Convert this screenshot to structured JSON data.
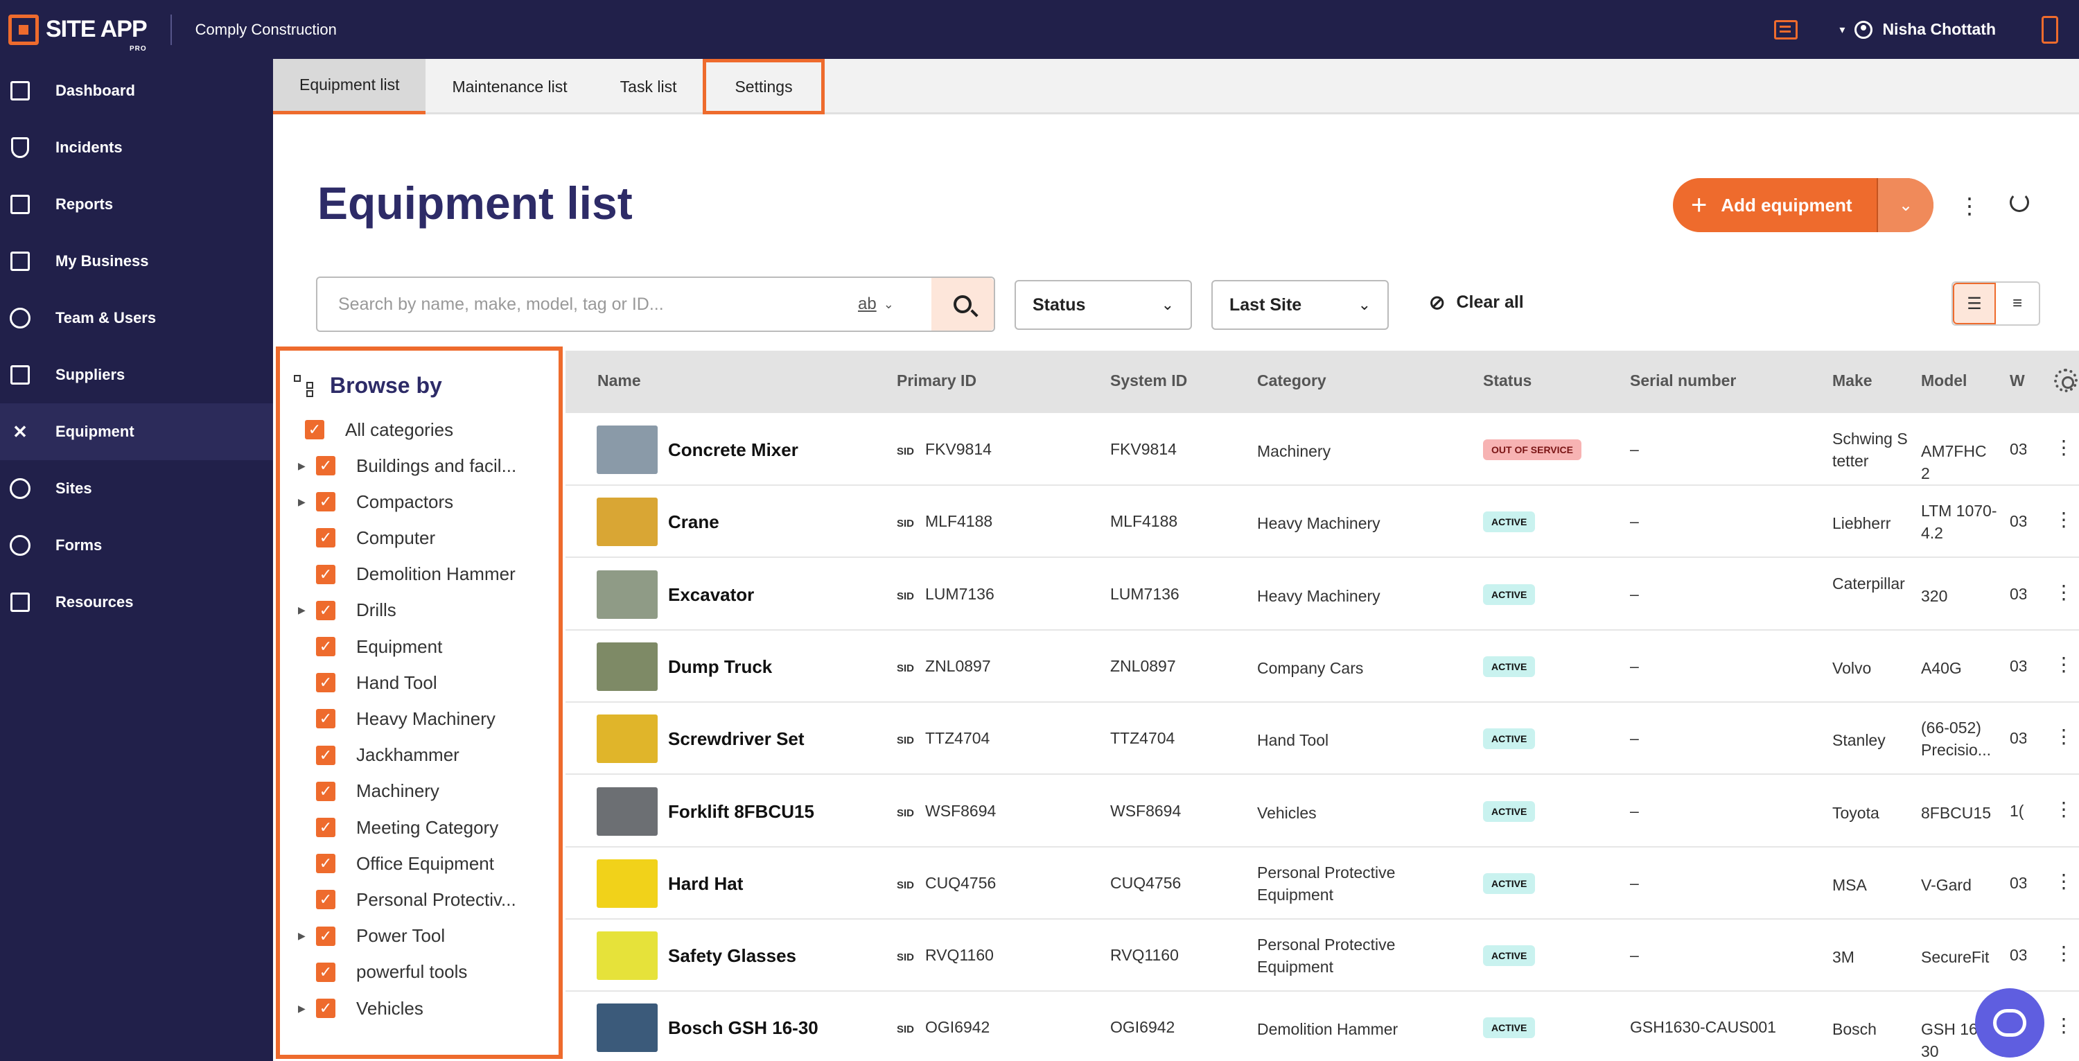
{
  "app": {
    "brand": "SITE APP",
    "brand_tier": "PRO",
    "company": "Comply Construction",
    "user": "Nisha Chottath"
  },
  "colors": {
    "accent": "#ee6b2d",
    "nav_bg": "#21204a",
    "title": "#2d2b67",
    "active_badge": "#c9f2ef",
    "out_badge": "#f7b3b3"
  },
  "nav": [
    {
      "label": "Dashboard",
      "icon": "dashboard-icon"
    },
    {
      "label": "Incidents",
      "icon": "shield-icon"
    },
    {
      "label": "Reports",
      "icon": "chart-icon"
    },
    {
      "label": "My Business",
      "icon": "store-icon"
    },
    {
      "label": "Team & Users",
      "icon": "face-icon"
    },
    {
      "label": "Suppliers",
      "icon": "truck-icon"
    },
    {
      "label": "Equipment",
      "icon": "tools-icon"
    },
    {
      "label": "Sites",
      "icon": "location-icon"
    },
    {
      "label": "Forms",
      "icon": "check-circle-icon"
    },
    {
      "label": "Resources",
      "icon": "copy-icon"
    }
  ],
  "tabs": [
    "Equipment list",
    "Maintenance list",
    "Task list",
    "Settings"
  ],
  "main": {
    "title": "Equipment list",
    "add_label": "Add equipment",
    "search_placeholder": "Search by name, make, model, tag or ID...",
    "ab_toggle": "ab",
    "status_filter": "Status",
    "site_filter": "Last Site",
    "clear_all": "Clear all"
  },
  "browse": {
    "title": "Browse by",
    "all": "All categories",
    "items": [
      {
        "label": "Buildings and facil...",
        "expandable": true
      },
      {
        "label": "Compactors",
        "expandable": true
      },
      {
        "label": "Computer",
        "expandable": false
      },
      {
        "label": "Demolition Hammer",
        "expandable": false
      },
      {
        "label": "Drills",
        "expandable": true
      },
      {
        "label": "Equipment",
        "expandable": false
      },
      {
        "label": "Hand Tool",
        "expandable": false
      },
      {
        "label": "Heavy Machinery",
        "expandable": false
      },
      {
        "label": "Jackhammer",
        "expandable": false
      },
      {
        "label": "Machinery",
        "expandable": false
      },
      {
        "label": "Meeting Category",
        "expandable": false
      },
      {
        "label": "Office Equipment",
        "expandable": false
      },
      {
        "label": "Personal Protectiv...",
        "expandable": false
      },
      {
        "label": "Power Tool",
        "expandable": true
      },
      {
        "label": "powerful tools",
        "expandable": false
      },
      {
        "label": "Vehicles",
        "expandable": true
      }
    ]
  },
  "table": {
    "columns": [
      "Name",
      "Primary ID",
      "System ID",
      "Category",
      "Status",
      "Serial number",
      "Make",
      "Model",
      "W"
    ],
    "sid_tag": "SID",
    "rows": [
      {
        "name": "Concrete Mixer",
        "primary_id": "FKV9814",
        "system_id": "FKV9814",
        "category": "Machinery",
        "status": "OUT OF SERVICE",
        "serial": "–",
        "make": "Schwing Stetter",
        "model": "AM7FHC 2",
        "w": "03",
        "thumb": "#8a9aa8"
      },
      {
        "name": "Crane",
        "primary_id": "MLF4188",
        "system_id": "MLF4188",
        "category": "Heavy Machinery",
        "status": "ACTIVE",
        "serial": "–",
        "make": "Liebherr",
        "model": "LTM 1070-4.2",
        "w": "03",
        "thumb": "#d9a634"
      },
      {
        "name": "Excavator",
        "primary_id": "LUM7136",
        "system_id": "LUM7136",
        "category": "Heavy Machinery",
        "status": "ACTIVE",
        "serial": "–",
        "make": "Caterpillar",
        "model": "320",
        "w": "03",
        "thumb": "#8f9b86"
      },
      {
        "name": "Dump Truck",
        "primary_id": "ZNL0897",
        "system_id": "ZNL0897",
        "category": "Company Cars",
        "status": "ACTIVE",
        "serial": "–",
        "make": "Volvo",
        "model": "A40G",
        "w": "03",
        "thumb": "#7e8a66"
      },
      {
        "name": "Screwdriver Set",
        "primary_id": "TTZ4704",
        "system_id": "TTZ4704",
        "category": "Hand Tool",
        "status": "ACTIVE",
        "serial": "–",
        "make": "Stanley",
        "model": "(66-052) Precisio...",
        "w": "03",
        "thumb": "#e0b52a"
      },
      {
        "name": "Forklift 8FBCU15",
        "primary_id": "WSF8694",
        "system_id": "WSF8694",
        "category": "Vehicles",
        "status": "ACTIVE",
        "serial": "–",
        "make": "Toyota",
        "model": "8FBCU15",
        "w": "1(",
        "thumb": "#6c6f73"
      },
      {
        "name": "Hard Hat",
        "primary_id": "CUQ4756",
        "system_id": "CUQ4756",
        "category": "Personal Protective Equipment",
        "status": "ACTIVE",
        "serial": "–",
        "make": "MSA",
        "model": "V-Gard",
        "w": "03",
        "thumb": "#f1d21a"
      },
      {
        "name": "Safety Glasses",
        "primary_id": "RVQ1160",
        "system_id": "RVQ1160",
        "category": "Personal Protective Equipment",
        "status": "ACTIVE",
        "serial": "–",
        "make": "3M",
        "model": "SecureFit",
        "w": "03",
        "thumb": "#e6e23a"
      },
      {
        "name": "Bosch GSH 16-30",
        "primary_id": "OGI6942",
        "system_id": "OGI6942",
        "category": "Demolition Hammer",
        "status": "ACTIVE",
        "serial": "GSH1630-CAUS001",
        "make": "Bosch",
        "model": "GSH 16-30",
        "w": "03",
        "thumb": "#3b5a7a"
      }
    ]
  }
}
